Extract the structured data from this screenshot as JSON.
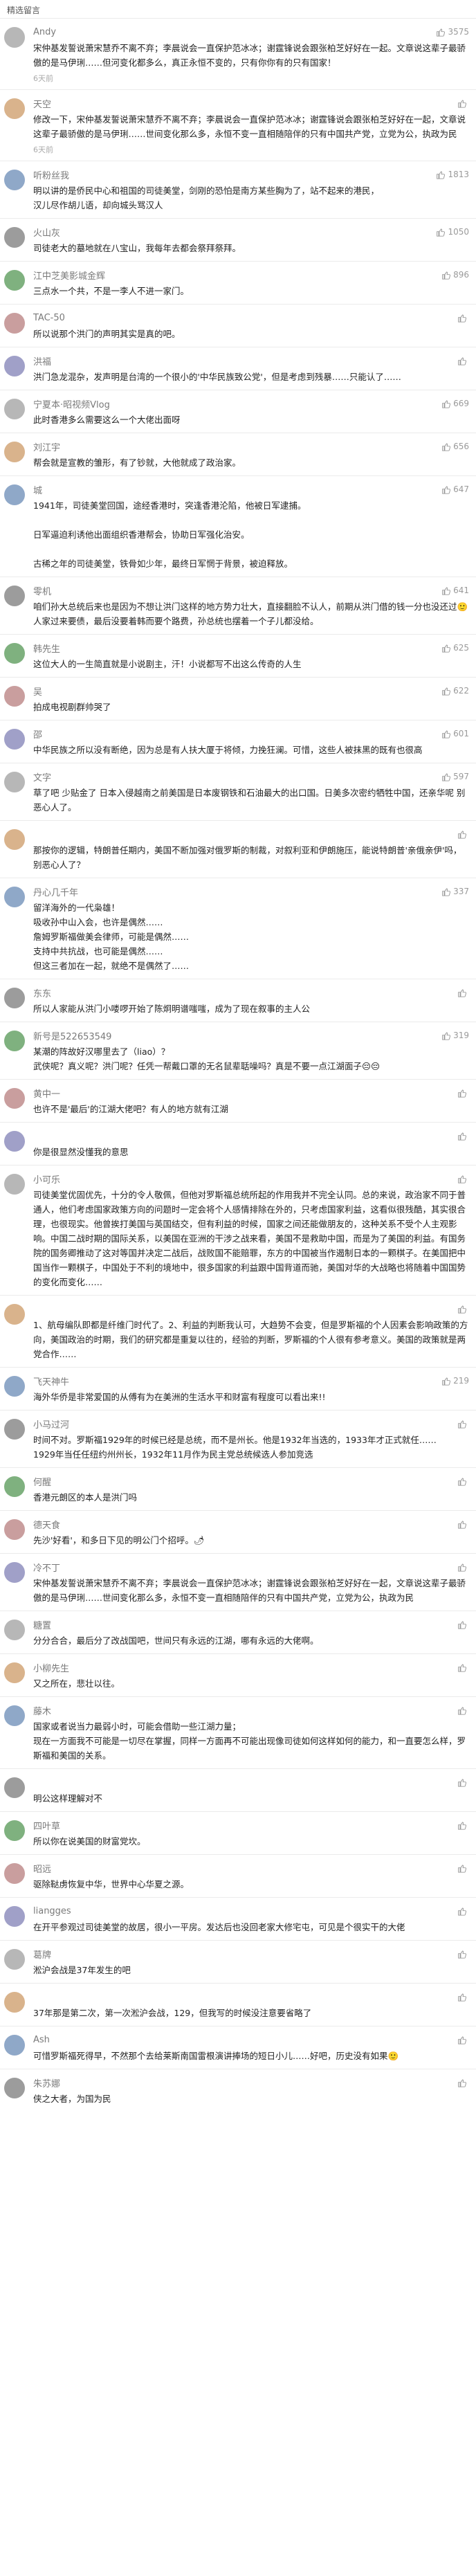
{
  "header": "精选留言",
  "colors": {
    "accent": "#f5a623",
    "avatar_palette": [
      "#b7b7b7",
      "#d9b38c",
      "#8fa8c8",
      "#9c9c9c",
      "#7fb17f",
      "#c99e9e",
      "#a0a0c8"
    ]
  },
  "comments": [
    {
      "user": "Andy",
      "likes": "3575",
      "avatar": "grey",
      "text": "宋仲基发誓说萧宋慧乔不离不弃；李晨说会一直保护范冰冰；谢霆锋说会跟张柏芝好好在一起。文章说这辈子最骄傲的是马伊琍……但河变化都多么，真正永恒不变的，只有你你有的只有国家！",
      "time": "6天前"
    },
    {
      "user": "天空",
      "likes": "",
      "avatar": "grey",
      "text": "修改一下，宋仲基发誓说萧宋慧乔不离不弃；李晨说会一直保护范冰冰；谢霆锋说会跟张柏芝好好在一起，文章说这辈子最骄傲的是马伊琍……世间变化那么多，永恒不变一直相随陪伴的只有中国共产党，立党为公，执政为民",
      "time": "6天前"
    },
    {
      "user": "听粉丝我",
      "likes": "1813",
      "avatar": "grey",
      "text": "明以讲的是侨民中心和祖国的司徒美堂，剑刚的恐怕是南方某些胸为了，站不起来的港民，\n汉儿尽作胡儿语，却向城头骂汉人",
      "time": ""
    },
    {
      "user": "火山灰",
      "likes": "1050",
      "avatar": "grey",
      "text": "司徒老大的墓地就在八宝山，我每年去都会祭拜祭拜。",
      "time": ""
    },
    {
      "user": "江中芝美影城金辉",
      "likes": "896",
      "avatar": "grey",
      "text": "三点水一个共，不是一李人不进一家门。",
      "time": ""
    },
    {
      "user": "TAC-50",
      "likes": "",
      "avatar": "grey",
      "text": "所以说那个洪门的声明其实是真的吧。",
      "time": ""
    },
    {
      "user": "洪福",
      "likes": "",
      "avatar": "grey",
      "text": "洪门急龙混杂，发声明是台湾的一个很小的'中华民族致公党'，但是考虑到残暴……只能认了……",
      "time": ""
    },
    {
      "user": "宁夏本·昭视频Vlog",
      "likes": "669",
      "avatar": "grey",
      "text": "此时香港多么需要这么一个大佬出面呀",
      "time": ""
    },
    {
      "user": "刘江宇",
      "likes": "656",
      "avatar": "grey",
      "text": "帮会就是宣教的雏形，有了钞就，大他就成了政治家。",
      "time": ""
    },
    {
      "user": "城",
      "likes": "647",
      "avatar": "grey",
      "text": "1941年，司徒美堂回国，途经香港时，突逢香港沦陷，他被日军逮捕。\n\n日军逼迫利诱他出面组织香港帮会，协助日军强化治安。\n\n古稀之年的司徒美堂，铁骨如少年，最终日军惘于背景，被迫释放。",
      "time": ""
    },
    {
      "user": "零机",
      "likes": "641",
      "avatar": "grey",
      "text": "咱们孙大总统后来也是因为不想让洪门这样的地方势力壮大，直接翻脸不认人，前期从洪门借的钱一分也没还过🙂人家过来要债，最后没要着韩而要个路费，孙总统也摆着一个子儿都没给。",
      "time": ""
    },
    {
      "user": "韩先生",
      "likes": "625",
      "avatar": "grey",
      "text": "这位大人的一生简直就是小说剧主，汗！小说都写不出这么传奇的人生",
      "time": ""
    },
    {
      "user": "吴",
      "likes": "622",
      "avatar": "grey",
      "text": "拍成电视剧群帅哭了",
      "time": ""
    },
    {
      "user": "邵",
      "likes": "601",
      "avatar": "grey",
      "text": "中华民族之所以没有断绝，因为总是有人扶大厦于将倾，力挽狂澜。可惜，这些人被抹黑的既有也很高",
      "time": ""
    },
    {
      "user": "文字",
      "likes": "597",
      "avatar": "grey",
      "text": "草了吧 少贴金了 日本入侵越南之前美国是日本废钢铁和石油最大的出口国。日美多次密约牺牲中国，还亲华呢 别恶心人了。",
      "time": ""
    },
    {
      "user": "",
      "likes": "",
      "avatar": "grey",
      "text": "那按你的逻辑，特朗普任期内，美国不断加强对俄罗斯的制裁，对叙利亚和伊朗施压，能说特朗普'亲俄亲伊'吗，别恶心人了？",
      "time": ""
    },
    {
      "user": "丹心几千年",
      "likes": "337",
      "avatar": "grey",
      "text": "留洋海外的一代枭雄！\n吸收孙中山入会，也许是偶然……\n詹姆罗斯福做美会律师，可能是偶然……\n支持中共抗战，也可能是偶然……\n但这三者加在一起，就绝不是偶然了……",
      "time": ""
    },
    {
      "user": "东东",
      "likes": "",
      "avatar": "grey",
      "text": "所以人家能从洪门小喽啰开始了陈炯明谱嗤嗤，成为了现在叙事的主人公",
      "time": ""
    },
    {
      "user": "新号是522653549",
      "likes": "319",
      "avatar": "grey",
      "text": "某潮的阵故好汉哪里去了（liao）？\n武侠呢？真义呢？洪门呢？任凭一帮戴口罩的无名鼠辈聒噪吗？真是不要一点江湖面子😔😔",
      "time": ""
    },
    {
      "user": "黄中一",
      "likes": "",
      "avatar": "grey",
      "text": "也许不是'最后'的江湖大佬吧？有人的地方就有江湖",
      "time": ""
    },
    {
      "user": "",
      "likes": "",
      "avatar": "grey",
      "text": "你是很显然没懂我的意思",
      "time": ""
    },
    {
      "user": "小可乐",
      "likes": "",
      "avatar": "grey",
      "text": "司徒美堂优固优先，十分的令人敬佩，但他对罗斯福总统所起的作用我并不完全认同。总的来说，政治家不同于普通人，他们考虑国家政策方向的问题时一定会将个人感情排除在外的，只考虑国家利益，这看似很残酷，其实很合理，也很现实。他曾挨打美国与英国结交，但有利益的时候，国家之间还能做朋友的，这种关系不受个人主观影响。中国二战时期的国际关系，以美国在亚洲的干涉之战来看，美国不是救助中国，而是为了美国的利益。有国务院的国务卿推动了这对等国并决定二战后，战败国不能赔罪，东方的中国被当作遏制日本的一颗棋子。在美国把中国当作一颗棋子，中国处于不利的境地中，很多国家的利益跟中国背道而驰，美国对华的大战略也将随着中国国势的变化而变化……",
      "time": ""
    },
    {
      "user": "",
      "likes": "",
      "avatar": "grey",
      "text": "1、航母编队即都是纤维门时代了。2、利益的判断我认可，大趋势不会变，但是罗斯福的个人因素会影响政策的方向，美国政治的时期，我们的研究都是重复以往的，经验的判断，罗斯福的个人很有参考意义。美国的政策就是两党合作……",
      "time": ""
    },
    {
      "user": "飞天神牛",
      "likes": "219",
      "avatar": "grey",
      "text": "海外华侨是非常爱国的从傅有为在美洲的生活水平和财富有程度可以看出来!!",
      "time": ""
    },
    {
      "user": "小马过河",
      "likes": "",
      "avatar": "grey",
      "text": "时间不对。罗斯福1929年的时候已经是总统，而不是州长。他是1932年当选的，1933年才正式就任……\n1929年当任任纽约州州长，1932年11月作为民主党总统候选人参加竞选",
      "time": ""
    },
    {
      "user": "何醒",
      "likes": "",
      "avatar": "grey",
      "text": "香港元朗区的本人是洪门吗",
      "time": ""
    },
    {
      "user": "德天食",
      "likes": "",
      "avatar": "grey",
      "text": "先沙'好看'，和多日下见的明公门个招呼。🌶",
      "time": ""
    },
    {
      "user": "冷不丁",
      "likes": "",
      "avatar": "grey",
      "text": "宋仲基发誓说萧宋慧乔不离不弃；李晨说会一直保护范冰冰；谢霆锋说会跟张柏芝好好在一起，文章说这辈子最骄傲的是马伊琍……世间变化那么多，永恒不变一直相随陪伴的只有中国共产党，立党为公，执政为民",
      "time": ""
    },
    {
      "user": "糖置",
      "likes": "",
      "avatar": "grey",
      "text": "分分合合，最后分了改战国吧，世间只有永远的江湖，哪有永远的大佬啊。",
      "time": ""
    },
    {
      "user": "小柳先生",
      "likes": "",
      "avatar": "grey",
      "text": "又之所在，悲壮以往。",
      "time": ""
    },
    {
      "user": "藤木",
      "likes": "",
      "avatar": "grey",
      "text": "国家或者说当力最弱小时，可能会借助一些江湖力量；\n现在一方面我不可能是一切尽在掌握，同样一方面再不可能出现像司徒如何这样如何的能力，和一直要怎么样，罗斯福和美国的关系。",
      "time": ""
    },
    {
      "user": "",
      "likes": "",
      "avatar": "grey",
      "text": "明公这样理解对不",
      "time": ""
    },
    {
      "user": "四叶草",
      "likes": "",
      "avatar": "grey",
      "text": "所以你在说美国的财富党坎。",
      "time": ""
    },
    {
      "user": "昭远",
      "likes": "",
      "avatar": "grey",
      "text": "驱除鞑虏恢复中华，世界中心华夏之源。",
      "time": ""
    },
    {
      "user": "liangges",
      "likes": "",
      "avatar": "grey",
      "text": "在开平参观过司徒美堂的故居，很小一平房。发达后也没回老家大修宅屯，可见是个很实干的大佬",
      "time": ""
    },
    {
      "user": "葛牌",
      "likes": "",
      "avatar": "grey",
      "text": "淞沪会战是37年发生的吧",
      "time": ""
    },
    {
      "user": "",
      "likes": "",
      "avatar": "grey",
      "text": "37年那是第二次，第一次淞沪会战，129，但我写的时候没注意要省略了",
      "time": ""
    },
    {
      "user": "Ash",
      "likes": "",
      "avatar": "grey",
      "text": "可惜罗斯福死得早，不然那个去给莱斯南国雷根演讲捧场的短日小儿……好吧，历史没有如果🙂",
      "time": ""
    },
    {
      "user": "朱苏娜",
      "likes": "",
      "avatar": "grey",
      "text": "侠之大者，为国为民",
      "time": ""
    }
  ]
}
